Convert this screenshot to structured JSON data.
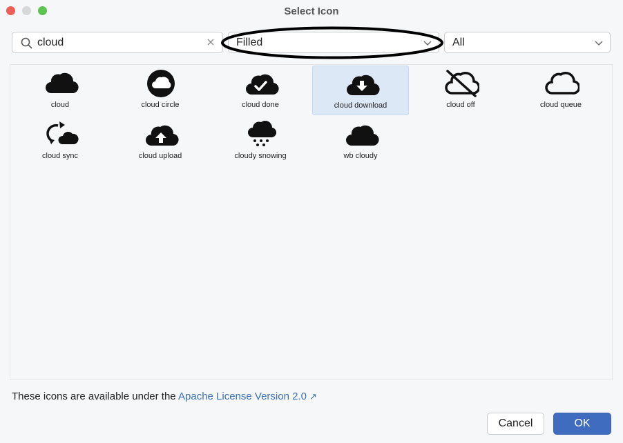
{
  "window": {
    "title": "Select Icon"
  },
  "search": {
    "value": "cloud",
    "icon": "search-icon",
    "clear_icon": "clear-icon"
  },
  "filters": {
    "style_selected": "Filled",
    "category_selected": "All"
  },
  "icons": [
    {
      "label": "cloud",
      "icon": "cloud-icon"
    },
    {
      "label": "cloud circle",
      "icon": "cloud-circle-icon"
    },
    {
      "label": "cloud done",
      "icon": "cloud-done-icon"
    },
    {
      "label": "cloud download",
      "icon": "cloud-download-icon",
      "selected": true
    },
    {
      "label": "cloud off",
      "icon": "cloud-off-icon"
    },
    {
      "label": "cloud queue",
      "icon": "cloud-queue-icon"
    },
    {
      "label": "cloud sync",
      "icon": "cloud-sync-icon"
    },
    {
      "label": "cloud upload",
      "icon": "cloud-upload-icon"
    },
    {
      "label": "cloudy snowing",
      "icon": "cloudy-snowing-icon"
    },
    {
      "label": "wb cloudy",
      "icon": "wb-cloudy-icon"
    }
  ],
  "license": {
    "text": "These icons are available under the",
    "link": "Apache License Version 2.0",
    "link_icon": "external-link-icon"
  },
  "buttons": {
    "cancel": "Cancel",
    "ok": "OK"
  },
  "colors": {
    "accent": "#3f6cbf",
    "selection": "#dce8f6",
    "link": "#3b6fb4"
  }
}
